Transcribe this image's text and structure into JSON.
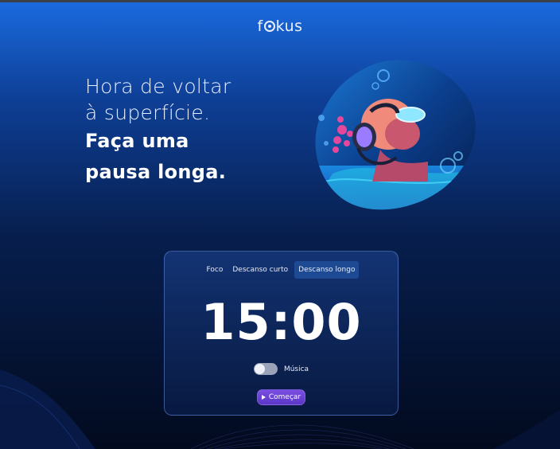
{
  "app": {
    "logo_text_left": "f",
    "logo_text_right": "kus"
  },
  "headline": {
    "line1": "Hora de voltar",
    "line2": "à superfície.",
    "line3": "Faça uma",
    "line4": "pausa longa."
  },
  "hero": {
    "image_alt": "Mergulhadora com fones de ouvido"
  },
  "timer_card": {
    "tabs": [
      {
        "label": "Foco",
        "active": false
      },
      {
        "label": "Descanso curto",
        "active": false
      },
      {
        "label": "Descanso longo",
        "active": true
      }
    ],
    "time": "15:00",
    "music_toggle": {
      "label": "Música",
      "enabled": false
    },
    "start_button": {
      "label": "Começar",
      "icon": "play-icon"
    }
  },
  "colors": {
    "accent": "#5b37c7",
    "active_tab": "#1d4a92",
    "bg_top": "#1a6be0",
    "bg_bottom": "#020a1e"
  }
}
